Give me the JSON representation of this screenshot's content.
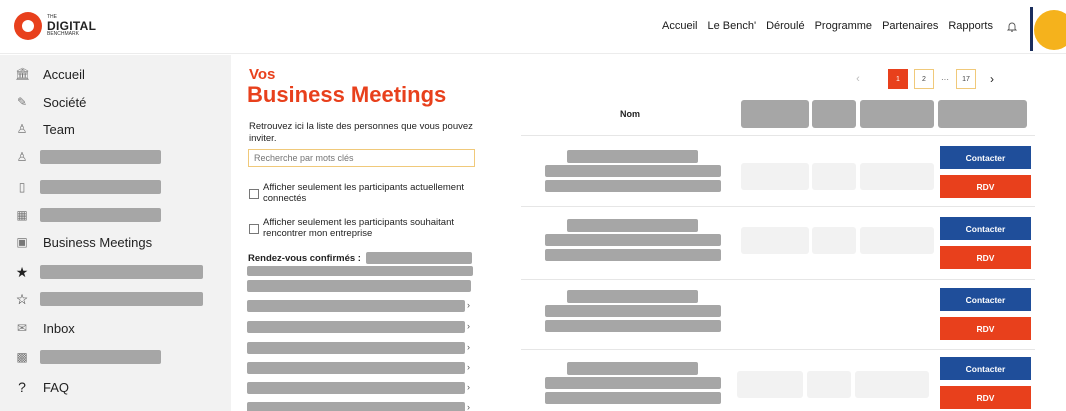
{
  "brand": {
    "line1": "THE",
    "line2": "DIGITAL",
    "line3": "BENCHMARK"
  },
  "nav": [
    "Accueil",
    "Le Bench'",
    "Déroulé",
    "Programme",
    "Partenaires",
    "Rapports"
  ],
  "sidebar": {
    "items": [
      {
        "icon": "bank-icon",
        "glyph": "🏛",
        "label": "Accueil"
      },
      {
        "icon": "pencil-icon",
        "glyph": "✎",
        "label": "Société"
      },
      {
        "icon": "team-icon",
        "glyph": "♙",
        "label": "Team"
      },
      {
        "icon": "person-icon",
        "glyph": "♙",
        "label": ""
      },
      {
        "icon": "document-icon",
        "glyph": "▯",
        "label": ""
      },
      {
        "icon": "calendar-icon",
        "glyph": "▦",
        "label": ""
      },
      {
        "icon": "meeting-icon",
        "glyph": "▣",
        "label": "Business Meetings"
      },
      {
        "icon": "star-filled-icon",
        "glyph": "★",
        "label": ""
      },
      {
        "icon": "star-outline-icon",
        "glyph": "☆",
        "label": ""
      },
      {
        "icon": "inbox-icon",
        "glyph": "✉",
        "label": "Inbox"
      },
      {
        "icon": "qr-icon",
        "glyph": "▩",
        "label": ""
      },
      {
        "icon": "question-icon",
        "glyph": "?",
        "label": "FAQ"
      }
    ]
  },
  "main": {
    "kicker": "Vos",
    "title": "Business Meetings",
    "intro": "Retrouvez ici la liste des personnes que vous pouvez inviter.",
    "search_placeholder": "Recherche par mots clés",
    "filter1": "Afficher seulement les participants actuellement connectés",
    "filter2": "Afficher seulement les participants souhaitant rencontrer mon entreprise",
    "confirmed_label": "Rendez-vous confirmés :",
    "chevron": "›"
  },
  "pagination": {
    "prev": "‹",
    "pages": [
      "1",
      "2"
    ],
    "ellipsis": "···",
    "last": "17",
    "next": "›",
    "current": "1"
  },
  "table": {
    "column_nom": "Nom",
    "contact_label": "Contacter",
    "rdv_label": "RDV"
  },
  "colors": {
    "accent": "#e8401c",
    "primary": "#1f4e9a",
    "avatar": "#f5b21c",
    "redacted": "#a6a6a6"
  }
}
